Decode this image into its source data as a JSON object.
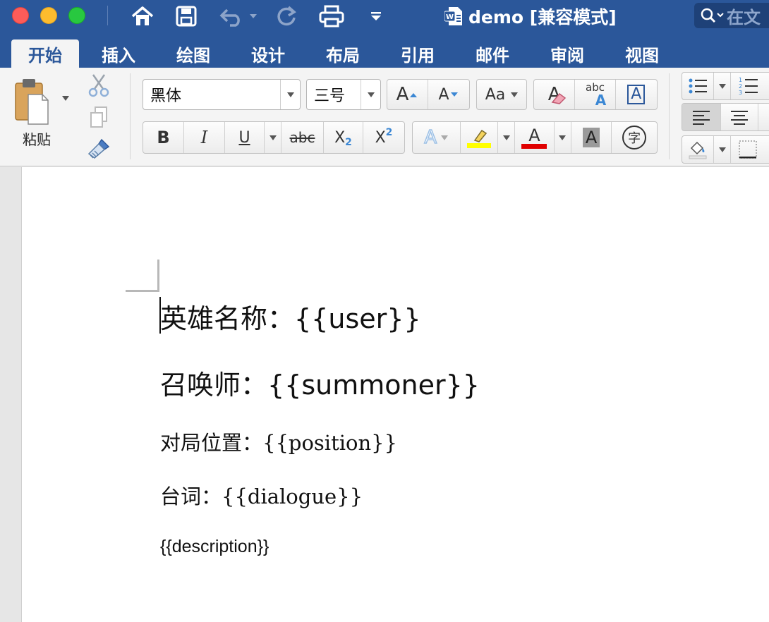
{
  "window": {
    "title": "demo [兼容模式]",
    "search_placeholder": "在文"
  },
  "colors": {
    "ribbon_blue": "#2b579a",
    "highlight_yellow": "#ffff00",
    "font_color_red": "#e00000"
  },
  "tabs": [
    {
      "label": "开始",
      "active": true
    },
    {
      "label": "插入"
    },
    {
      "label": "绘图"
    },
    {
      "label": "设计"
    },
    {
      "label": "布局"
    },
    {
      "label": "引用"
    },
    {
      "label": "邮件"
    },
    {
      "label": "审阅"
    },
    {
      "label": "视图"
    }
  ],
  "clipboard": {
    "paste_label": "粘贴"
  },
  "font": {
    "family": "黑体",
    "size": "三号"
  },
  "format_buttons": {
    "bold": "B",
    "italic": "I",
    "underline": "U",
    "strike": "abc",
    "subscript": "X",
    "subscript_mark": "2",
    "superscript": "X",
    "superscript_mark": "2",
    "grow": "A",
    "shrink": "A",
    "change_case": "Aa",
    "clear_format": "A",
    "spelling": "abc",
    "spelling_mark": "A",
    "text_border": "A",
    "text_effect": "A",
    "font_color": "A",
    "char_shading": "A",
    "enclose": "字"
  },
  "document": {
    "paragraphs": [
      "英雄名称：{{user}}",
      "召唤师：{{summoner}}",
      "对局位置：{{position}}",
      "台词：{{dialogue}}",
      "{{description}}"
    ]
  }
}
